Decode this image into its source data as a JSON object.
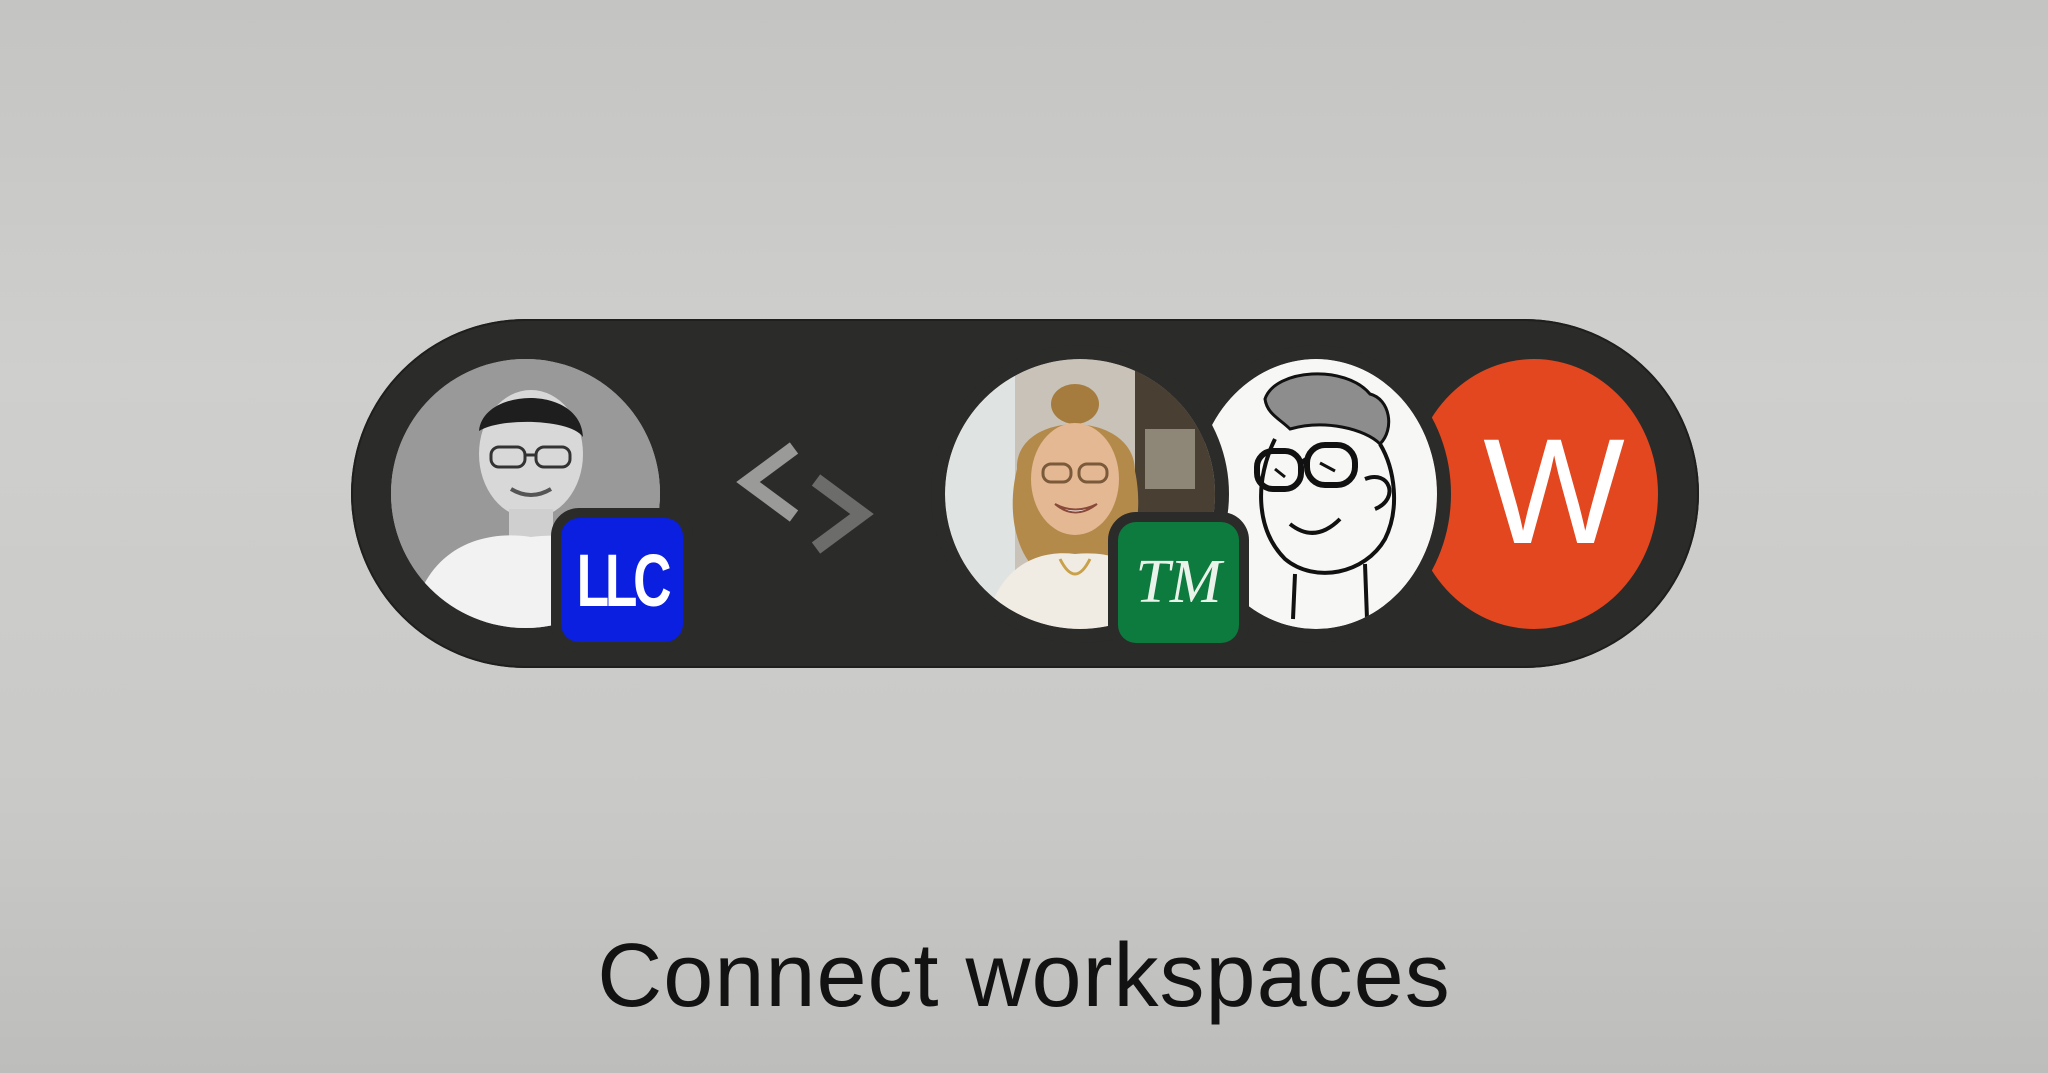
{
  "caption": "Connect workspaces",
  "left_workspace": {
    "avatar_icon": "person-photo-man",
    "badge_label": "LLC",
    "badge_color": "#0a1fe0"
  },
  "connector": {
    "icon": "swap-arrows-icon"
  },
  "right_workspaces": {
    "avatars": [
      {
        "icon": "person-photo-woman",
        "badge_label": "TM",
        "badge_color": "#0d7a3e"
      },
      {
        "icon": "sketch-portrait"
      },
      {
        "icon": "letter-avatar",
        "letter": "W",
        "color": "#e2471f"
      }
    ]
  },
  "colors": {
    "pill": "#2b2b2a",
    "background": "#c9c9c7"
  }
}
